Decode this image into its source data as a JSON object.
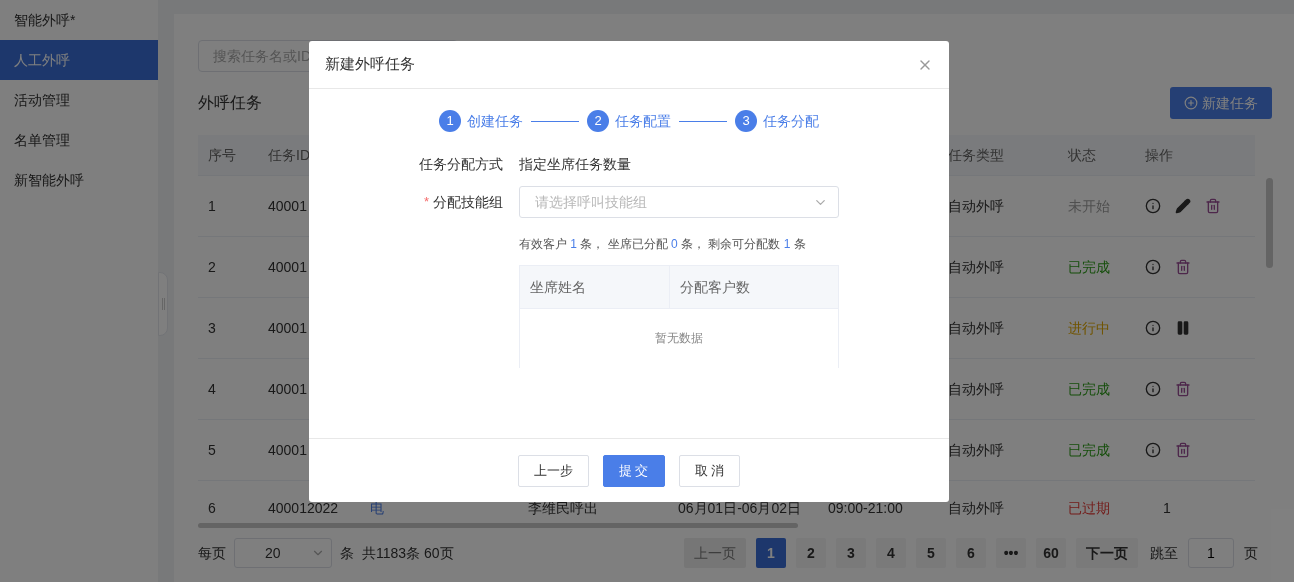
{
  "sidebar": {
    "items": [
      {
        "label": "智能外呼*",
        "selected": false
      },
      {
        "label": "人工外呼",
        "selected": true
      },
      {
        "label": "活动管理",
        "selected": false
      },
      {
        "label": "名单管理",
        "selected": false
      },
      {
        "label": "新智能外呼",
        "selected": false
      }
    ]
  },
  "search": {
    "placeholder": "搜索任务名或ID"
  },
  "page_title": "外呼任务",
  "new_button": "新建任务",
  "table": {
    "columns": [
      "序号",
      "任务ID",
      "任务类型",
      "状态",
      "操作"
    ],
    "rows": [
      {
        "index": "1",
        "task_id": "40001",
        "type": "自动外呼",
        "status": {
          "text": "未开始",
          "kind": "pending"
        },
        "actions": [
          {
            "kind": "info"
          },
          {
            "kind": "edit"
          },
          {
            "kind": "delete"
          }
        ]
      },
      {
        "index": "2",
        "task_id": "40001",
        "type": "自动外呼",
        "status": {
          "text": "已完成",
          "kind": "done"
        },
        "actions": [
          {
            "kind": "info"
          },
          {
            "kind": "delete"
          }
        ]
      },
      {
        "index": "3",
        "task_id": "40001",
        "type": "自动外呼",
        "status": {
          "text": "进行中",
          "kind": "running"
        },
        "actions": [
          {
            "kind": "info"
          },
          {
            "kind": "pause"
          }
        ]
      },
      {
        "index": "4",
        "task_id": "40001",
        "type": "自动外呼",
        "status": {
          "text": "已完成",
          "kind": "done"
        },
        "actions": [
          {
            "kind": "info"
          },
          {
            "kind": "delete"
          }
        ]
      },
      {
        "index": "5",
        "task_id": "40001",
        "type": "自动外呼",
        "status": {
          "text": "已完成",
          "kind": "done"
        },
        "actions": [
          {
            "kind": "info"
          },
          {
            "kind": "delete"
          }
        ]
      },
      {
        "index": "6",
        "task_id": "400012022",
        "column_3": "电",
        "column_4": "李维民呼出",
        "column_5": "06月01日-06月02日",
        "column_6": "09:00-21:00",
        "type": "自动外呼",
        "status": {
          "text": "已过期",
          "kind": "expired"
        },
        "action_text": "1"
      }
    ]
  },
  "pagination": {
    "per_page_label": "每页",
    "per_page": "20",
    "unit": "条",
    "total": "共1183条 60页",
    "pages": [
      {
        "label": "上一页",
        "kind": "nav",
        "disabled": true,
        "selected": false
      },
      {
        "label": "1",
        "kind": "page",
        "disabled": false,
        "selected": true
      },
      {
        "label": "2",
        "kind": "page",
        "disabled": false,
        "selected": false
      },
      {
        "label": "3",
        "kind": "page",
        "disabled": false,
        "selected": false
      },
      {
        "label": "4",
        "kind": "page",
        "disabled": false,
        "selected": false
      },
      {
        "label": "5",
        "kind": "page",
        "disabled": false,
        "selected": false
      },
      {
        "label": "6",
        "kind": "page",
        "disabled": false,
        "selected": false
      },
      {
        "label": "•••",
        "kind": "page",
        "disabled": false,
        "selected": false
      },
      {
        "label": "60",
        "kind": "page",
        "disabled": false,
        "selected": false
      },
      {
        "label": "下一页",
        "kind": "nav",
        "disabled": false,
        "selected": false
      }
    ],
    "jump_label": "跳至",
    "jump_value": "1",
    "jump_unit": "页"
  },
  "dialog": {
    "title": "新建外呼任务",
    "steps": [
      {
        "number": "1",
        "label": "创建任务",
        "done": true
      },
      {
        "number": "2",
        "label": "任务配置",
        "done": true
      },
      {
        "number": "3",
        "label": "任务分配",
        "done": true
      }
    ],
    "method_label": "任务分配方式",
    "method_value": "指定坐席任务数量",
    "group_label": "分配技能组",
    "group_required_mark": "*",
    "group_placeholder": "请选择呼叫技能组",
    "summary": [
      {
        "text": "有效客户 ",
        "highlight": false
      },
      {
        "text": "1",
        "highlight": true
      },
      {
        "text": " 条， 坐席已分配 ",
        "highlight": false
      },
      {
        "text": "0",
        "highlight": true
      },
      {
        "text": " 条， 剩余可分配数 ",
        "highlight": false
      },
      {
        "text": "1",
        "highlight": true
      },
      {
        "text": " 条",
        "highlight": false
      }
    ],
    "agent_table": {
      "columns": [
        "坐席姓名",
        "分配客户数"
      ],
      "empty_text": "暂无数据"
    },
    "buttons": [
      {
        "label": "上一步",
        "kind": "default"
      },
      {
        "label": "提 交",
        "kind": "primary"
      },
      {
        "label": "取 消",
        "kind": "default"
      }
    ]
  }
}
